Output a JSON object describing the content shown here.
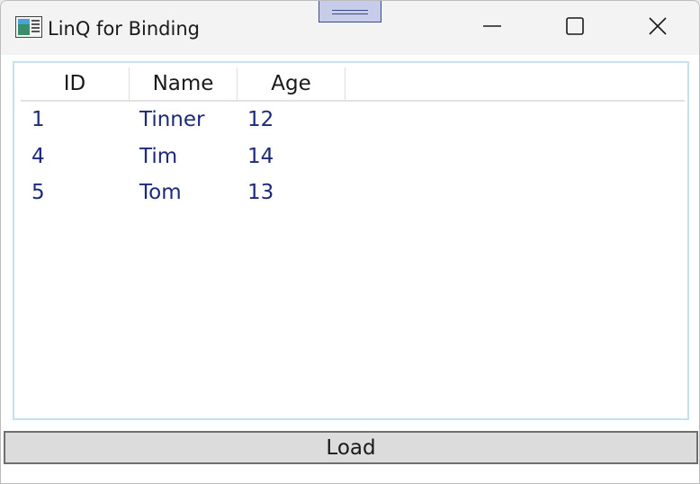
{
  "window": {
    "title": "LinQ for Binding",
    "icons": {
      "app": "app-window-icon",
      "grip": "drag-grip-icon",
      "minimize": "minimize-icon",
      "maximize": "maximize-icon",
      "close": "close-icon"
    }
  },
  "listview": {
    "columns": [
      "ID",
      "Name",
      "Age"
    ],
    "rows": [
      {
        "id": "1",
        "name": "Tinner",
        "age": "12"
      },
      {
        "id": "4",
        "name": "Tim",
        "age": "14"
      },
      {
        "id": "5",
        "name": "Tom",
        "age": "13"
      }
    ],
    "colors": {
      "text": "#1c2a7a",
      "border": "#c5e0ef"
    }
  },
  "buttons": {
    "load_label": "Load"
  }
}
